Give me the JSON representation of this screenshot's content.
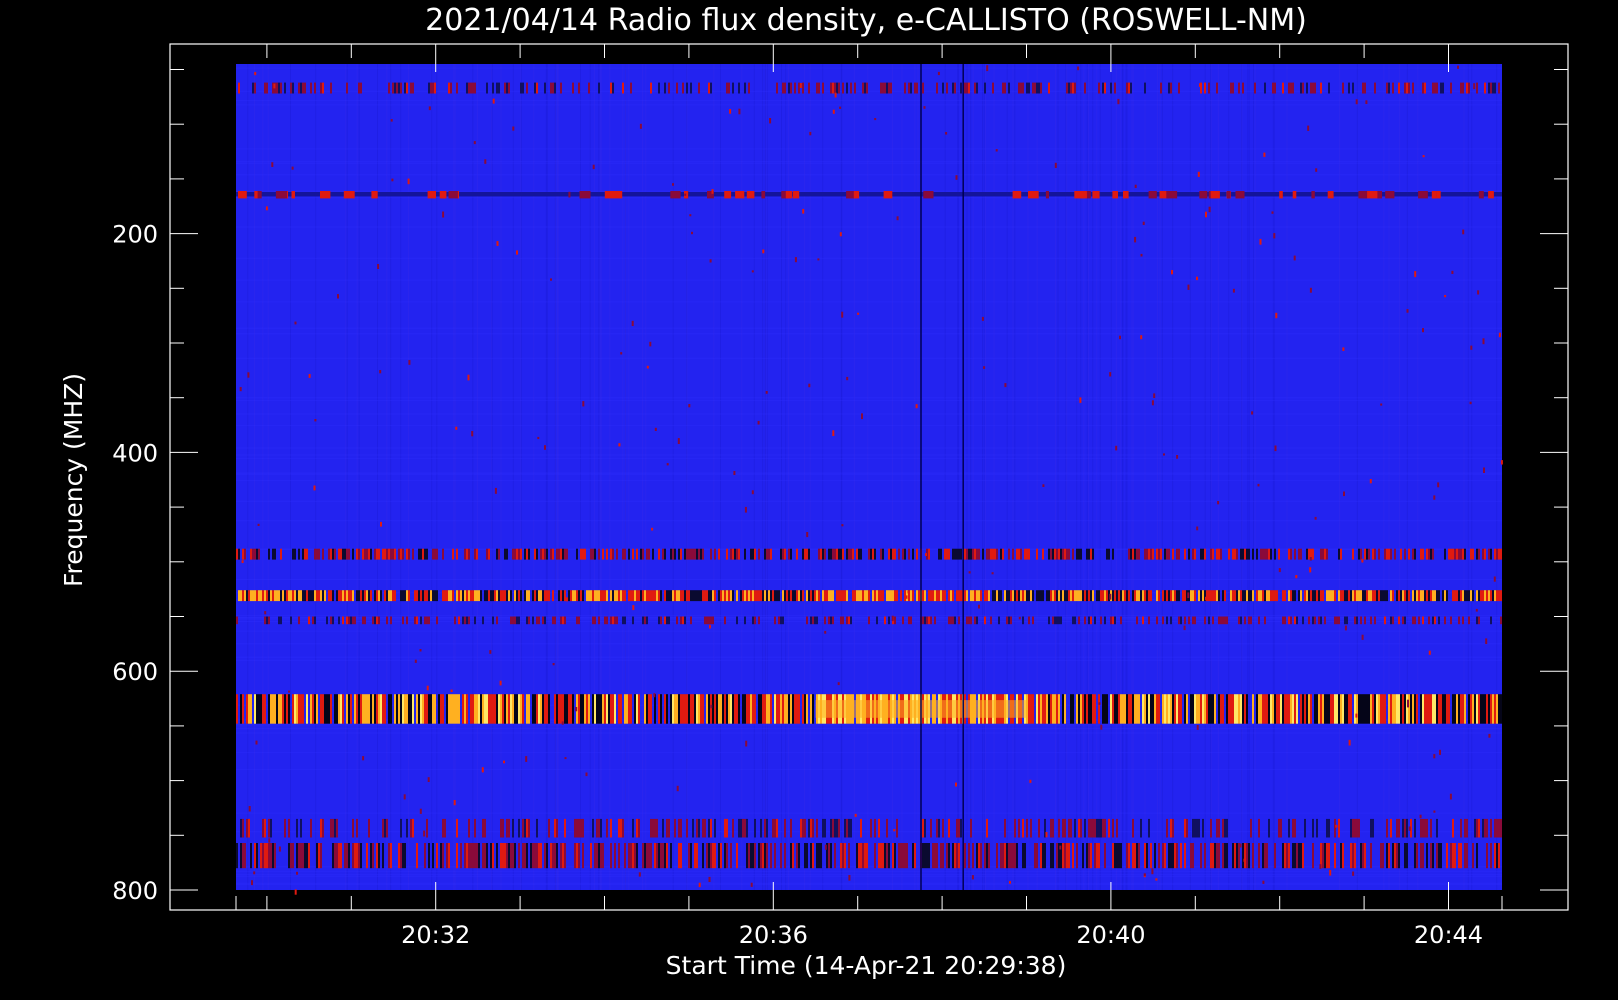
{
  "chart_data": {
    "type": "heatmap",
    "title": "2021/04/14  Radio flux density, e-CALLISTO (ROSWELL-NM)",
    "xlabel": "Start Time (14-Apr-21 20:29:38)",
    "ylabel": "Frequency (MHZ)",
    "x_tick_labels": [
      "20:32",
      "20:36",
      "20:40",
      "20:44"
    ],
    "y_tick_labels": [
      "200",
      "400",
      "600",
      "800"
    ],
    "x_range": [
      "20:29:38",
      "20:44:38"
    ],
    "ylim": [
      45,
      800
    ],
    "y_inverted": true,
    "colors": {
      "background": "#000000",
      "base": "#2323f0",
      "low": "#8a0a3a",
      "mid": "#e01a10",
      "high": "#ffb020",
      "peak": "#ffe866"
    },
    "bands": [
      {
        "freq_range": [
          62,
          72
        ],
        "intensity": "low-speckle"
      },
      {
        "freq_range": [
          162,
          166
        ],
        "intensity": "mid-spotty"
      },
      {
        "freq_range": [
          488,
          498
        ],
        "intensity": "mid-speckle"
      },
      {
        "freq_range": [
          526,
          536
        ],
        "intensity": "high-speckle",
        "peak_time_range": [
          "20:36:30",
          "20:38:30"
        ]
      },
      {
        "freq_range": [
          550,
          557
        ],
        "intensity": "low-speckle"
      },
      {
        "freq_range": [
          621,
          648
        ],
        "intensity": "peak-speckle",
        "peak_time_range": [
          "20:36:30",
          "20:39:00"
        ]
      },
      {
        "freq_range": [
          735,
          752
        ],
        "intensity": "low-speckle"
      },
      {
        "freq_range": [
          757,
          780
        ],
        "intensity": "mid-speckle"
      }
    ],
    "vertical_lines": [
      "20:37:45",
      "20:38:15"
    ]
  }
}
